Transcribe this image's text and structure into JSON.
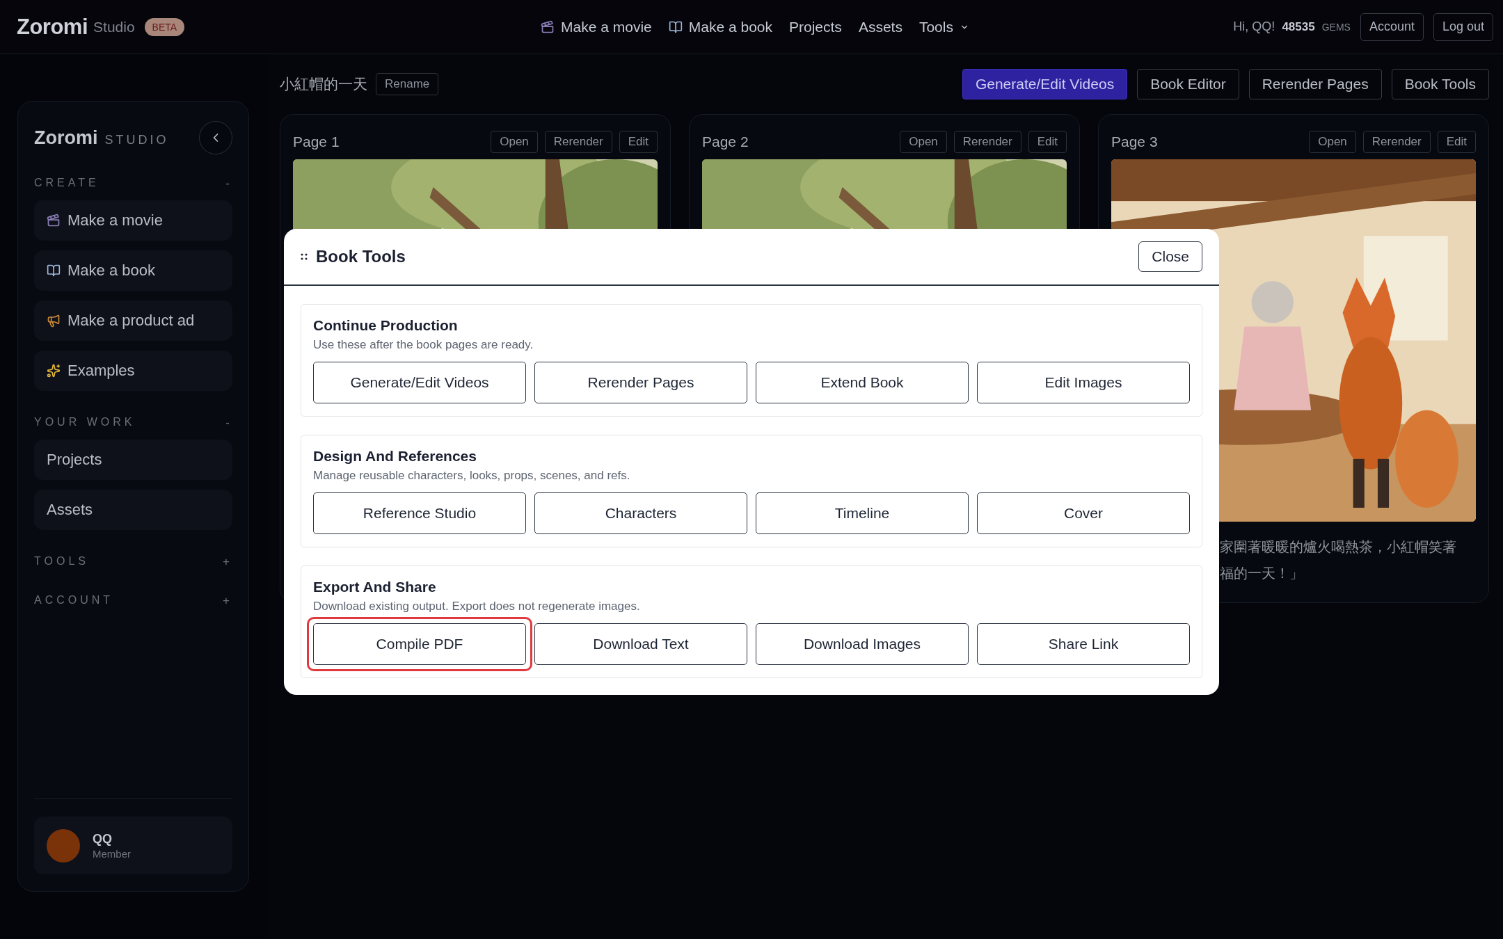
{
  "top_bar": {
    "logo": "Zoromi",
    "logo_sub": "Studio",
    "badge": "BETA",
    "nav": [
      {
        "label": "Make a movie",
        "kind": "movie"
      },
      {
        "label": "Make a book",
        "kind": "book"
      },
      {
        "label": "Projects",
        "kind": "link"
      },
      {
        "label": "Assets",
        "kind": "link"
      },
      {
        "label": "Tools",
        "kind": "menu"
      }
    ],
    "greeting": "Hi, QQ!",
    "gems": "48535",
    "gems_unit": "GEMS",
    "buttons": [
      "Account",
      "Log out"
    ]
  },
  "sidebar": {
    "logo": "Zoromi",
    "logo_sub": "STUDIO",
    "sections": [
      {
        "title": "CREATE",
        "toggle": "-",
        "items": [
          {
            "label": "Make a movie",
            "kind": "movie"
          },
          {
            "label": "Make a book",
            "kind": "book"
          },
          {
            "label": "Make a product ad",
            "kind": "ad"
          },
          {
            "label": "Examples",
            "kind": "sparkle"
          }
        ]
      },
      {
        "title": "YOUR WORK",
        "toggle": "-",
        "items": [
          {
            "label": "Projects",
            "kind": "plain"
          },
          {
            "label": "Assets",
            "kind": "plain"
          }
        ]
      },
      {
        "title": "TOOLS",
        "toggle": "+"
      },
      {
        "title": "ACCOUNT",
        "toggle": "+"
      }
    ],
    "user": {
      "name": "QQ",
      "role": "Member"
    }
  },
  "project": {
    "title": "小紅帽的一天",
    "rename": "Rename",
    "actions": [
      {
        "label": "Generate/Edit Videos",
        "selected": true
      },
      {
        "label": "Book Editor",
        "selected": false
      },
      {
        "label": "Rerender Pages",
        "selected": false
      },
      {
        "label": "Book Tools",
        "selected": false
      }
    ]
  },
  "pages": [
    {
      "title": "Page 1",
      "buttons": [
        "Open",
        "Rerender",
        "Edit"
      ]
    },
    {
      "title": "Page 2",
      "buttons": [
        "Open",
        "Rerender",
        "Edit"
      ]
    },
    {
      "title": "Page 3",
      "buttons": [
        "Open",
        "Rerender",
        "Edit"
      ],
      "caption_lines": [
        "家圍著暖暖的爐火喝熱茶，小紅帽笑著",
        "福的一天！」"
      ]
    }
  ],
  "modal": {
    "title": "Book Tools",
    "close": "Close",
    "sections": [
      {
        "title": "Continue Production",
        "description": "Use these after the book pages are ready.",
        "buttons": [
          {
            "label": "Generate/Edit Videos",
            "highlighted": false
          },
          {
            "label": "Rerender Pages",
            "highlighted": false
          },
          {
            "label": "Extend Book",
            "highlighted": false
          },
          {
            "label": "Edit Images",
            "highlighted": false
          }
        ]
      },
      {
        "title": "Design And References",
        "description": "Manage reusable characters, looks, props, scenes, and refs.",
        "buttons": [
          {
            "label": "Reference Studio",
            "highlighted": false
          },
          {
            "label": "Characters",
            "highlighted": false
          },
          {
            "label": "Timeline",
            "highlighted": false
          },
          {
            "label": "Cover",
            "highlighted": false
          }
        ]
      },
      {
        "title": "Export And Share",
        "description": "Download existing output. Export does not regenerate images.",
        "buttons": [
          {
            "label": "Compile PDF",
            "highlighted": true
          },
          {
            "label": "Download Text",
            "highlighted": false
          },
          {
            "label": "Download Images",
            "highlighted": false
          },
          {
            "label": "Share Link",
            "highlighted": false
          }
        ]
      }
    ]
  }
}
